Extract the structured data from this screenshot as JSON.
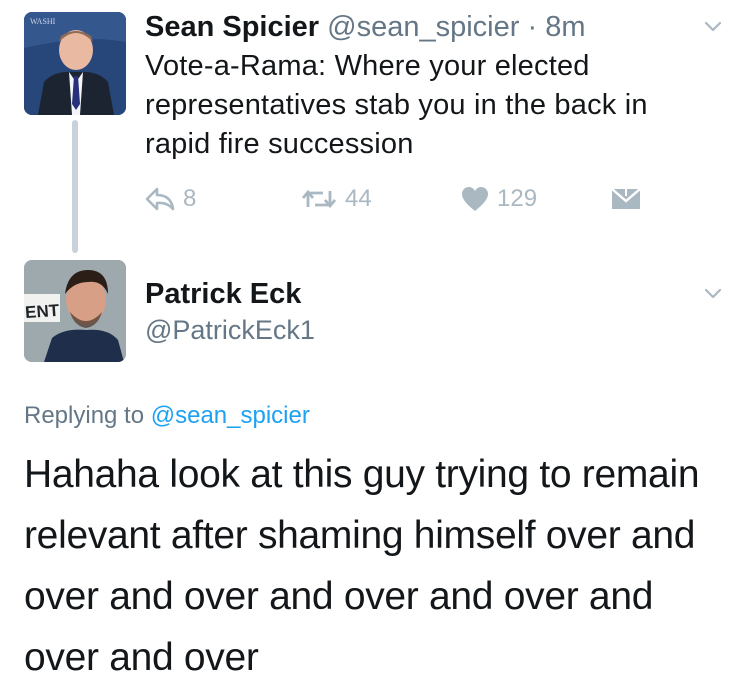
{
  "tweet1": {
    "author_name": "Sean Spicier",
    "handle": "@sean_spicier",
    "separator": "·",
    "time": "8m",
    "text": "Vote-a-Rama: Where your elected representatives stab you in the back in rapid fire succession",
    "reply_count": "8",
    "retweet_count": "44",
    "like_count": "129",
    "avatar_caption": "WASHI"
  },
  "tweet2": {
    "author_name": "Patrick Eck",
    "handle": "@PatrickEck1",
    "replying_prefix": "Replying to",
    "replying_to": "@sean_spicier",
    "text": "Hahaha look at this guy trying to remain relevant after shaming himself over and over and over and over and over and over and over",
    "avatar_sign_text": "ENT"
  },
  "icons": {
    "reply": "reply-icon",
    "retweet": "retweet-icon",
    "like": "heart-icon",
    "dm": "envelope-icon",
    "menu": "chevron-down-icon"
  },
  "colors": {
    "text": "#14171a",
    "muted": "#657786",
    "action_gray": "#aab8c2",
    "link_blue": "#1da1f2",
    "thread_line": "#c9d2db"
  }
}
